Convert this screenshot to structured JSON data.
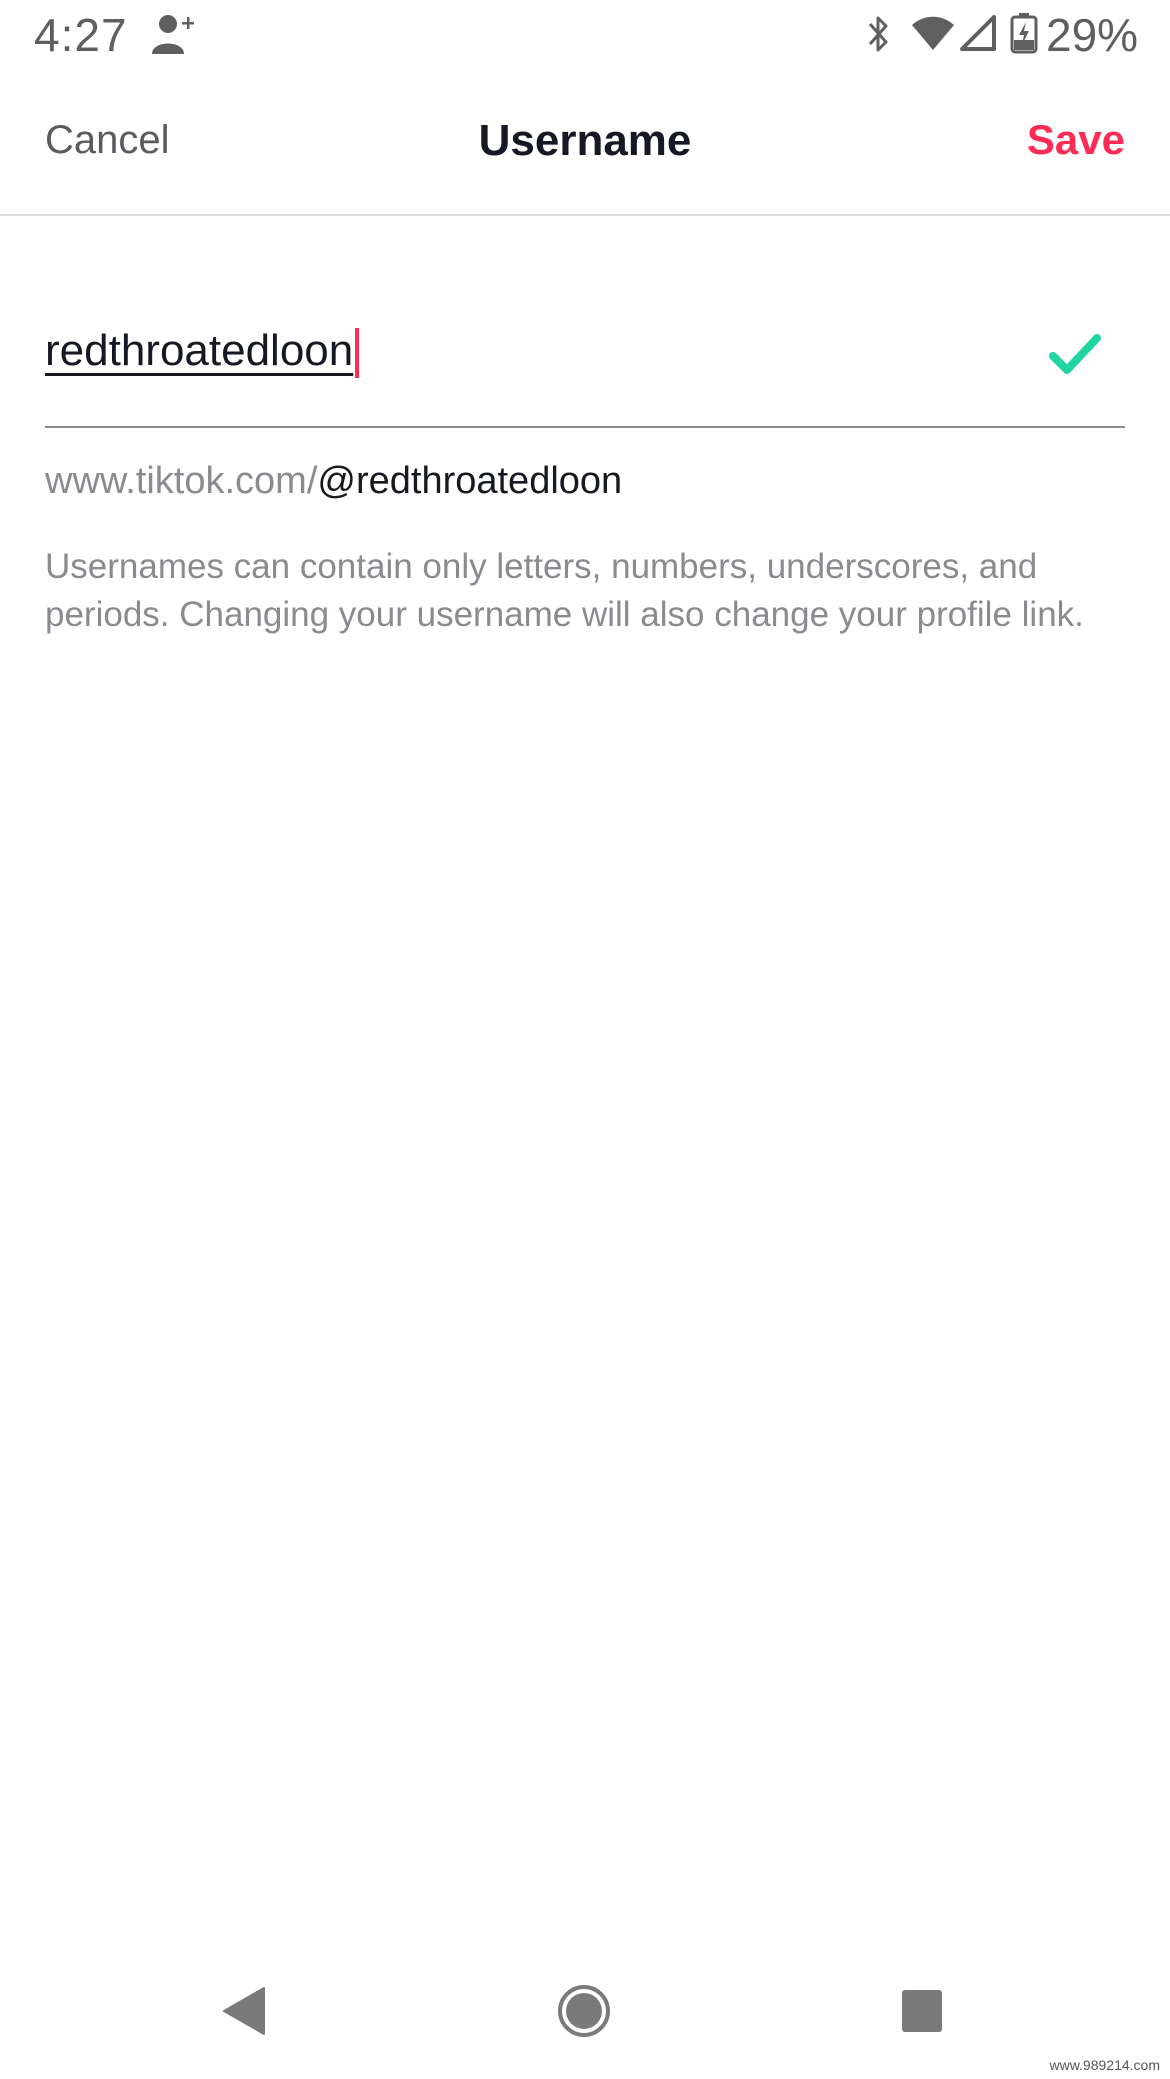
{
  "status_bar": {
    "time": "4:27",
    "battery_percent": "29%",
    "icons": [
      "add-user-icon",
      "bluetooth-icon",
      "wifi-icon",
      "signal-icon",
      "battery-charging-icon"
    ]
  },
  "header": {
    "cancel_label": "Cancel",
    "title": "Username",
    "save_label": "Save"
  },
  "username_field": {
    "value": "redthroatedloon",
    "valid": true
  },
  "profile_link": {
    "prefix": "www.tiktok.com/",
    "handle": "@redthroatedloon"
  },
  "hint": "Usernames can contain only letters, numbers, underscores, and periods. Changing your username will also change your profile link.",
  "system_nav": {
    "icons": [
      "back-icon",
      "home-icon",
      "recents-icon"
    ]
  },
  "watermark": "www.989214.com",
  "colors": {
    "accent": "#fe2c55",
    "valid": "#20d5a0",
    "text_primary": "#161823",
    "text_secondary": "#8a8b91"
  }
}
